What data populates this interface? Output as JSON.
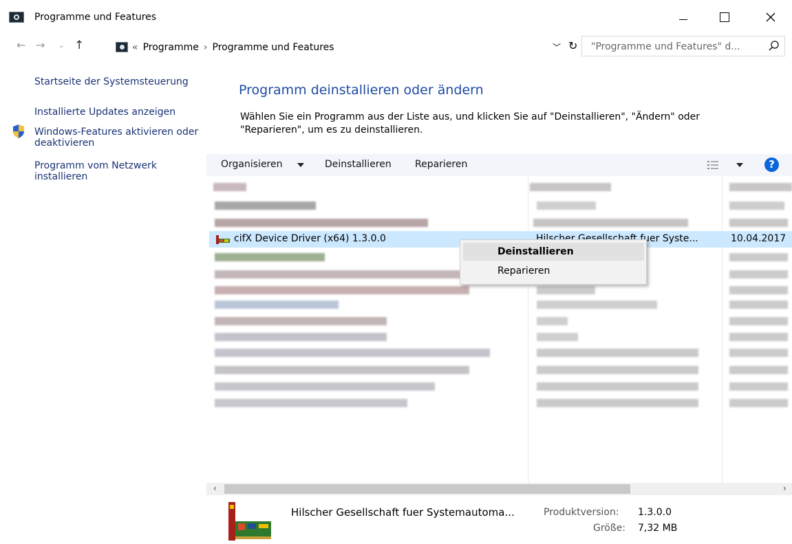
{
  "window": {
    "title": "Programme und Features",
    "controls": {
      "minimize": "—",
      "maximize": "☐",
      "close": "✕"
    }
  },
  "nav": {
    "breadcrumb": [
      "«",
      "Programme",
      "›",
      "Programme und Features"
    ],
    "search_placeholder": "\"Programme und Features\" d..."
  },
  "sidebar": {
    "items": [
      {
        "label": "Startseite der Systemsteuerung"
      },
      {
        "label": "Installierte Updates anzeigen"
      },
      {
        "label": "Windows-Features aktivieren oder deaktivieren",
        "icon": "shield-icon"
      },
      {
        "label": "Programm vom Netzwerk installieren"
      }
    ]
  },
  "main": {
    "title": "Programm deinstallieren oder ändern",
    "description": "Wählen Sie ein Programm aus der Liste aus, und klicken Sie auf \"Deinstallieren\", \"Ändern\" oder \"Reparieren\", um es zu deinstallieren."
  },
  "toolbar": {
    "organize": "Organisieren",
    "uninstall": "Deinstallieren",
    "repair": "Reparieren",
    "help": "?"
  },
  "list": {
    "selected": {
      "name": "cifX Device Driver (x64) 1.3.0.0",
      "publisher": "Hilscher Gesellschaft fuer Syste...",
      "date": "10.04.2017"
    }
  },
  "context_menu": {
    "items": [
      "Deinstallieren",
      "Reparieren"
    ]
  },
  "scrollbar": {
    "left": "‹",
    "right": "›"
  },
  "details": {
    "publisher": "Hilscher Gesellschaft fuer Systemautoma...",
    "version_label": "Produktversion:",
    "version_value": "1.3.0.0",
    "size_label": "Größe:",
    "size_value": "7,32 MB"
  },
  "colors": {
    "link": "#1a3275",
    "title": "#1e4aa6",
    "selection": "#cce8ff",
    "toolbar_bg": "#f2f5fa"
  }
}
